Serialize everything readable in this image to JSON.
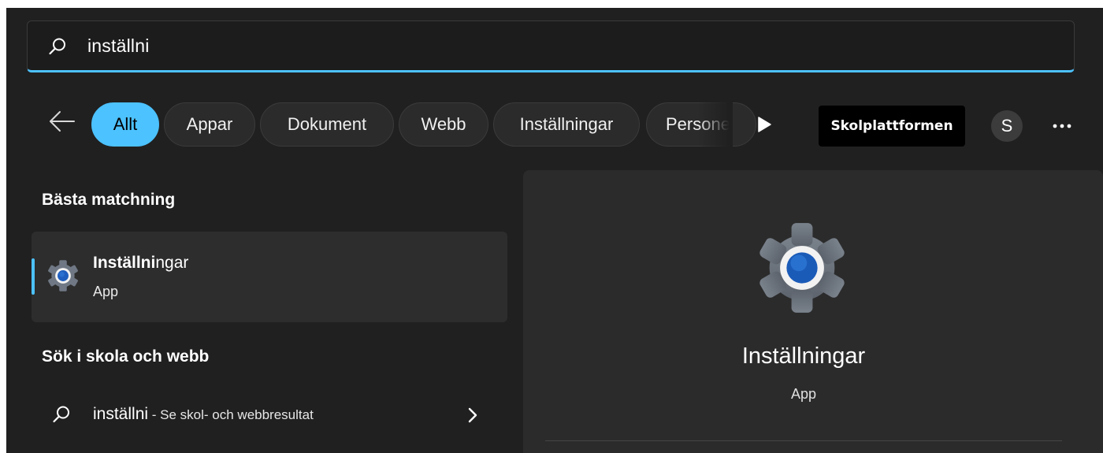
{
  "search": {
    "query": "inställni",
    "icon": "search-icon"
  },
  "filters": {
    "back_icon": "arrow-left-icon",
    "chips": [
      {
        "label": "Allt",
        "active": true
      },
      {
        "label": "Appar",
        "active": false
      },
      {
        "label": "Dokument",
        "active": false
      },
      {
        "label": "Webb",
        "active": false
      },
      {
        "label": "Inställningar",
        "active": false
      },
      {
        "label": "Persone",
        "active": false
      }
    ],
    "play_icon": "play-icon",
    "org_badge": "Skolplattformen",
    "avatar_initial": "S",
    "more_icon": "more-horizontal-icon"
  },
  "best_match": {
    "heading": "Bästa matchning",
    "item": {
      "title_match": "Inställni",
      "title_rest": "ngar",
      "subtitle": "App",
      "icon": "settings-gear-icon"
    }
  },
  "web_search": {
    "heading": "Sök i skola och webb",
    "query": "inställni",
    "hint": " - Se skol- och webbresultat",
    "icon": "search-icon",
    "chevron_icon": "chevron-right-icon"
  },
  "detail": {
    "title": "Inställningar",
    "subtitle": "App",
    "icon": "settings-gear-icon"
  },
  "colors": {
    "accent": "#4cc2ff",
    "background": "#202020",
    "panel": "#2b2b2b"
  }
}
